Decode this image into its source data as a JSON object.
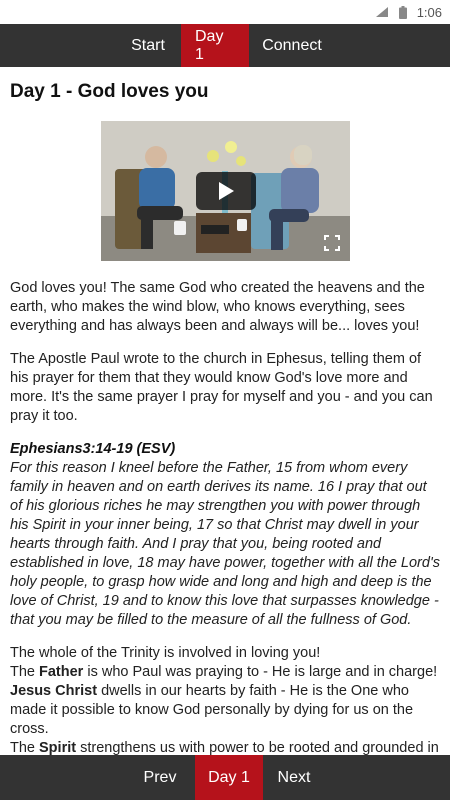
{
  "status_bar": {
    "time": "1:06",
    "signal_icon": "signal-icon",
    "battery_icon": "battery-icon"
  },
  "top_nav": {
    "tabs": [
      {
        "label": "Start"
      },
      {
        "label": "Day 1"
      },
      {
        "label": "Connect"
      }
    ],
    "active": "Day 1"
  },
  "page": {
    "title": "Day 1 - God loves you",
    "video": {
      "play_icon": "play-icon",
      "fullscreen_icon": "fullscreen-icon"
    },
    "p1": "God loves you! The same God who created the heavens and the earth, who makes the wind blow, who knows everything, sees everything and has always been and always will be... loves you!",
    "p2": "The Apostle Paul wrote to the church in Ephesus, telling them of his prayer for them that they would know God's love more and more. It's the same prayer I pray for myself and you - and you can pray it too.",
    "reference": "Ephesians3:14-19 (ESV)",
    "scripture": "For this reason I kneel before the Father, 15 from whom every family in heaven and on earth derives its name. 16 I pray that out of his glorious riches he may strengthen you with power through his Spirit in your inner being, 17 so that Christ may dwell in your hearts through faith. And I pray that you, being rooted and established in love, 18 may have power, together with all the Lord's holy people, to grasp how wide and long and high and deep is the love of Christ, 19 and to know this love that surpasses knowledge - that you may be filled to the measure of all the fullness of God.",
    "trinity_intro": "The whole of the Trinity is involved in loving you!",
    "father": {
      "name": "Father",
      "pre": "The ",
      "text": " is who Paul was praying to - He is large and in charge!"
    },
    "jesus": {
      "name": "Jesus Christ",
      "text": " dwells in our hearts by faith - He is the One who made it possible to know God personally by dying for us on the cross."
    },
    "spirit": {
      "name": "Spirit",
      "pre": "The ",
      "text": " strengthens us with power to be rooted and grounded in love."
    }
  },
  "bottom_nav": {
    "prev": "Prev",
    "current": "Day 1",
    "next": "Next"
  },
  "colors": {
    "nav_bg": "#333333",
    "accent": "#b5121b"
  }
}
